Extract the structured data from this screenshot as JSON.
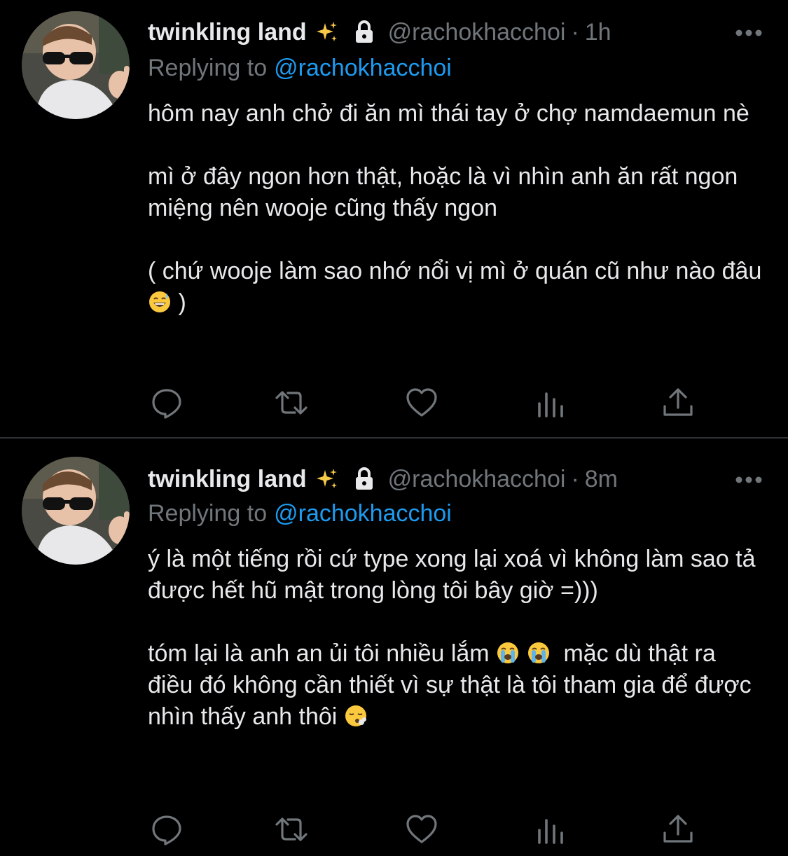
{
  "tweets": [
    {
      "display_name": "twinkling land",
      "name_emoji": "sparkles",
      "handle": "@rachokhacchoi",
      "separator": "·",
      "time": "1h",
      "replying_label": "Replying to",
      "replying_handle": "@rachokhacchoi",
      "paragraphs": [
        "hôm nay anh chở đi ăn mì thái tay ở chợ namdaemun nè",
        "mì ở đây ngon hơn thật, hoặc là vì nhìn anh ăn rất ngon miệng nên wooje cũng thấy ngon",
        "( chứ wooje làm sao nhớ nổi vị mì ở quán cũ như nào đâu",
        ")"
      ]
    },
    {
      "display_name": "twinkling land",
      "name_emoji": "sparkles",
      "handle": "@rachokhacchoi",
      "separator": "·",
      "time": "8m",
      "replying_label": "Replying to",
      "replying_handle": "@rachokhacchoi",
      "paragraphs": [
        "ý là một tiếng rồi cứ type xong lại xoá vì không làm sao tả được hết hũ mật trong lòng tôi bây giờ =)))",
        "tóm lại là anh an ủi tôi nhiều lắm",
        "mặc dù thật ra điều đó không cần thiết vì sự thật là tôi tham gia để được nhìn thấy anh thôi"
      ]
    }
  ],
  "icons": {
    "lock": "lock-icon",
    "more": "more-dots-icon",
    "reply": "reply-bubble-icon",
    "retweet": "retweet-icon",
    "like": "heart-icon",
    "views": "views-bar-chart-icon",
    "share": "share-upload-icon",
    "emoji_tweet1": "grinning-sweat-emoji",
    "emoji_tweet2": [
      "crying-emoji",
      "crying-emoji",
      "exhaling-face-emoji"
    ]
  },
  "colors": {
    "background": "#000000",
    "text": "#e7e9ea",
    "secondary": "#71767b",
    "link": "#1d9bf0",
    "divider": "#2f3336"
  }
}
